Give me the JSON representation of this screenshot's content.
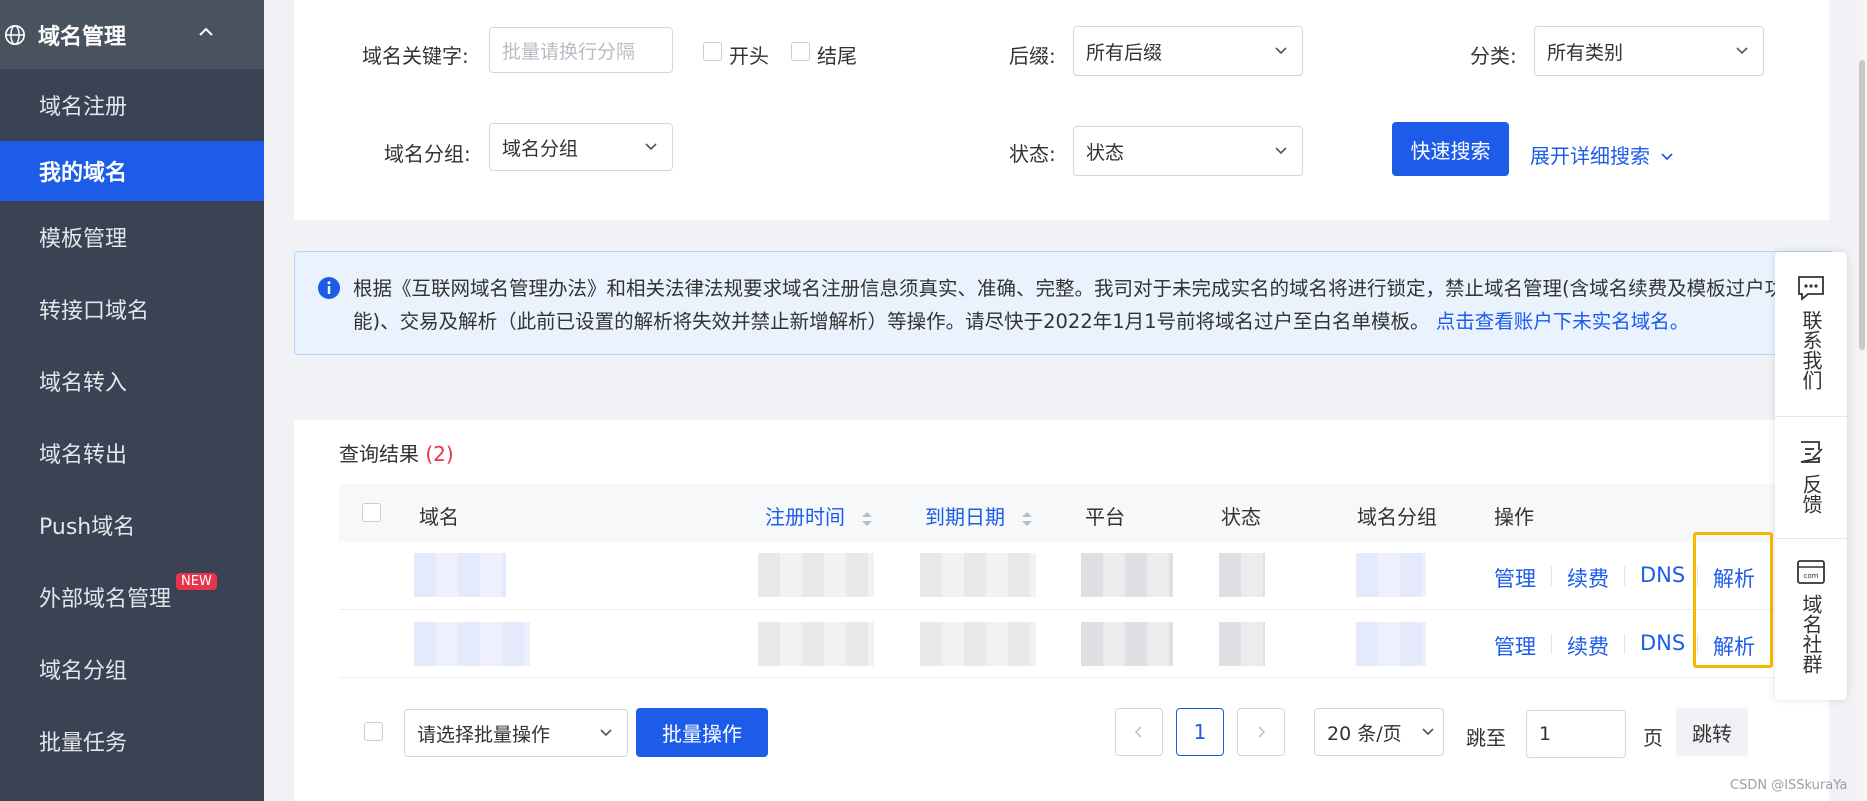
{
  "sidebar": {
    "header": "域名管理",
    "items": [
      {
        "label": "域名注册"
      },
      {
        "label": "我的域名"
      },
      {
        "label": "模板管理"
      },
      {
        "label": "转接口域名"
      },
      {
        "label": "域名转入"
      },
      {
        "label": "域名转出"
      },
      {
        "label": "Push域名"
      },
      {
        "label": "外部域名管理",
        "badge": "NEW"
      },
      {
        "label": "域名分组"
      },
      {
        "label": "批量任务"
      }
    ]
  },
  "search": {
    "keyword_label": "域名关键字:",
    "keyword_placeholder": "批量请换行分隔",
    "start_label": "开头",
    "end_label": "结尾",
    "suffix_label": "后缀:",
    "suffix_value": "所有后缀",
    "category_label": "分类:",
    "category_value": "所有类别",
    "group_label": "域名分组:",
    "group_value": "域名分组",
    "status_label": "状态:",
    "status_value": "状态",
    "quick_search": "快速搜索",
    "expand_search": "展开详细搜索"
  },
  "notice": {
    "text": "根据《互联网域名管理办法》和相关法律法规要求域名注册信息须真实、准确、完整。我司对于未完成实名的域名将进行锁定，禁止域名管理(含域名续费及模板过户功能)、交易及解析（此前已设置的解析将失效并禁止新增解析）等操作。请尽快于2022年1月1号前将域名过户至白名单模板。",
    "link": "点击查看账户下未实名域名。"
  },
  "results": {
    "title": "查询结果",
    "count": "(2)",
    "columns": {
      "domain": "域名",
      "reg_time": "注册时间",
      "expire": "到期日期",
      "platform": "平台",
      "status": "状态",
      "group": "域名分组",
      "ops": "操作"
    },
    "row_ops": {
      "manage": "管理",
      "renew": "续费",
      "dns": "DNS",
      "resolve": "解析"
    }
  },
  "footer": {
    "batch_placeholder": "请选择批量操作",
    "batch_button": "批量操作",
    "page_current": "1",
    "page_size": "20 条/页",
    "jump_label": "跳至",
    "jump_value": "1",
    "page_label": "页",
    "jump_button": "跳转"
  },
  "float_bar": {
    "contact": "联系我们",
    "feedback": "反馈",
    "community": "域名社群"
  },
  "watermark": "CSDN @ISSkuraYa",
  "colors": {
    "primary": "#1d5ce8",
    "sidebar": "#394353",
    "highlight": "#f6b900",
    "count": "#e8334a"
  }
}
